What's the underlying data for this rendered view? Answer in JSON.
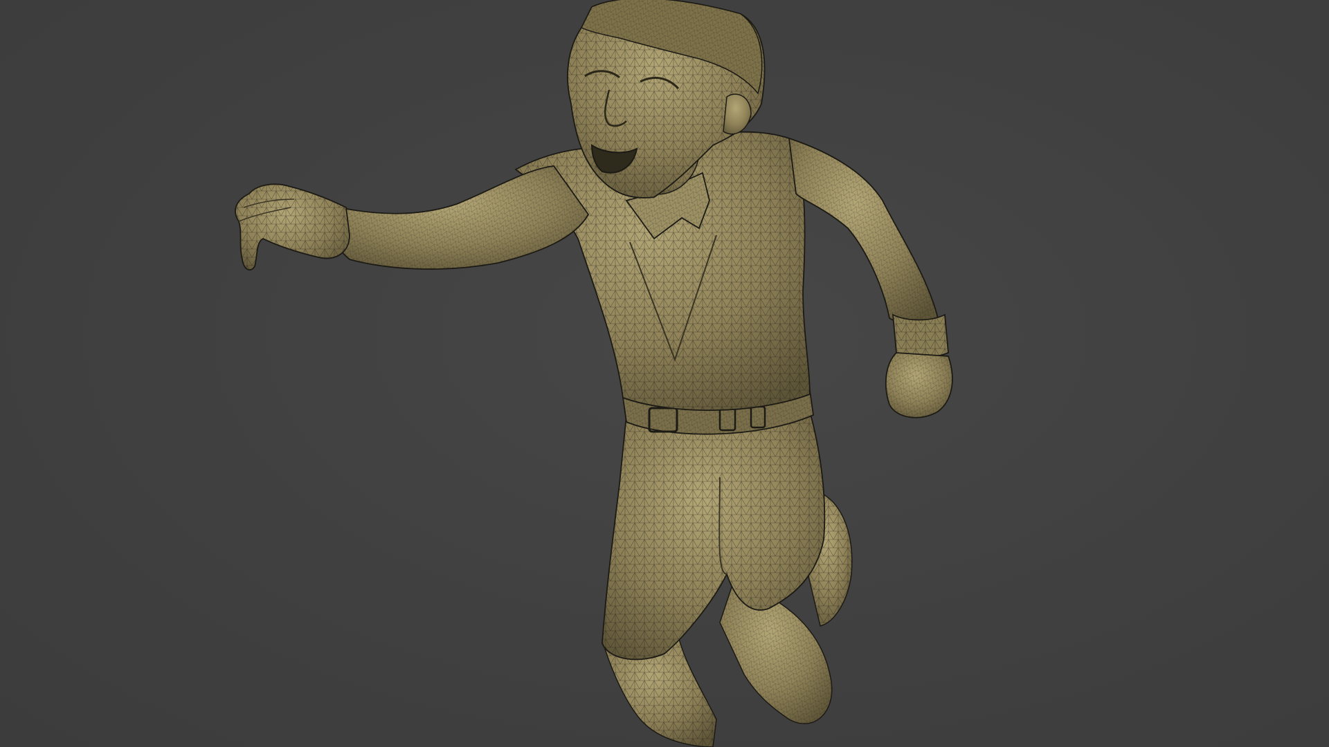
{
  "viewport": {
    "background_color": "#404040",
    "model": {
      "subject": "running-boy-figure",
      "surface_color": "#8f8258",
      "shadow_color": "#5e5538",
      "highlight_color": "#b3a676",
      "wire_color": "#1c1a14",
      "display_mode": "wireframe-on-shaded"
    }
  }
}
